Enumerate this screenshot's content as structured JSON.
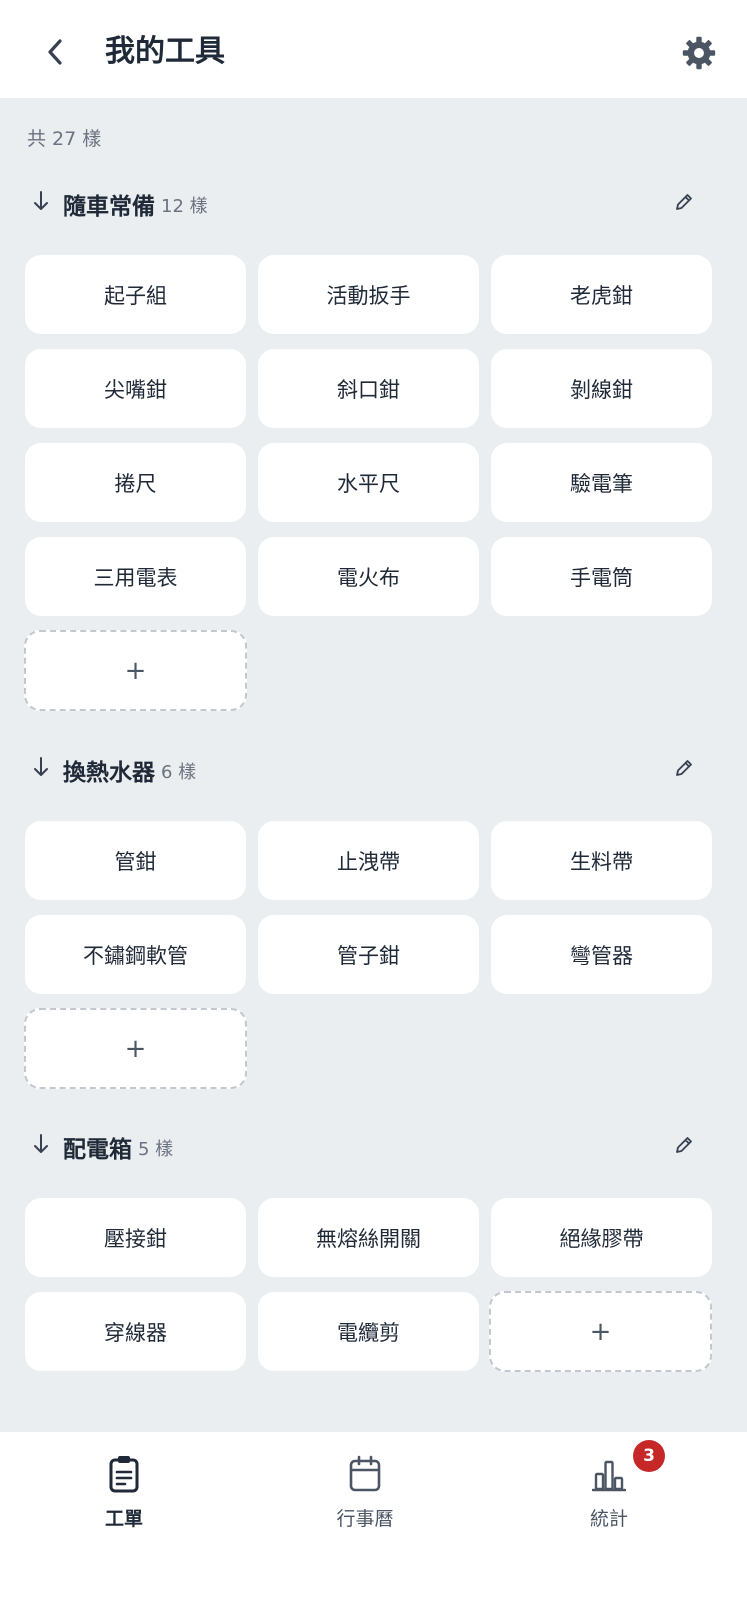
{
  "header": {
    "title": "我的工具",
    "back_icon": "chevron-left-icon",
    "settings_icon": "gear-icon"
  },
  "summary": {
    "total_label": "共 27 樣"
  },
  "groups": [
    {
      "title": "隨車常備",
      "count_label": "12 樣",
      "tools": [
        "起子組",
        "活動扳手",
        "老虎鉗",
        "尖嘴鉗",
        "斜口鉗",
        "剝線鉗",
        "捲尺",
        "水平尺",
        "驗電筆",
        "三用電表",
        "電火布",
        "手電筒"
      ],
      "add_label": "+"
    },
    {
      "title": "換熱水器",
      "count_label": "6 樣",
      "tools": [
        "管鉗",
        "止洩帶",
        "生料帶",
        "不鏽鋼軟管",
        "管子鉗",
        "彎管器"
      ],
      "add_label": "+"
    },
    {
      "title": "配電箱",
      "count_label": "5 樣",
      "tools": [
        "壓接鉗",
        "無熔絲開關",
        "絕緣膠帶",
        "穿線器",
        "電纜剪"
      ],
      "add_label": "+"
    }
  ],
  "bottom_nav": {
    "items": [
      {
        "label": "工單",
        "icon": "clipboard-icon",
        "active": true
      },
      {
        "label": "行事曆",
        "icon": "calendar-icon",
        "active": false
      },
      {
        "label": "統計",
        "icon": "bar-chart-icon",
        "active": false
      }
    ],
    "badge": "3"
  },
  "colors": {
    "background": "#ebeef1",
    "surface": "#ffffff",
    "text_primary": "#1f2937",
    "text_secondary": "#6b7280",
    "badge": "#c62828"
  }
}
